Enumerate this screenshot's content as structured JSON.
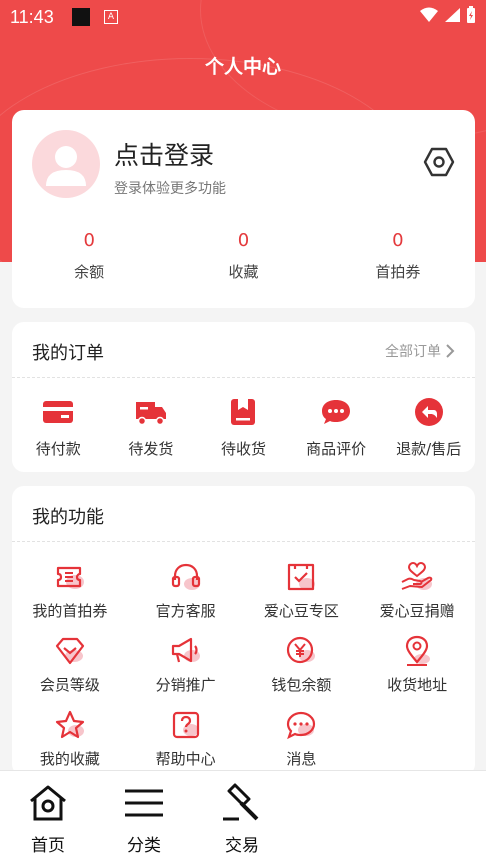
{
  "statusbar": {
    "time": "11:43",
    "a_icon": "A"
  },
  "page_title": "个人中心",
  "profile": {
    "login_title": "点击登录",
    "login_subtitle": "登录体验更多功能",
    "stats": [
      {
        "value": "0",
        "label": "余额"
      },
      {
        "value": "0",
        "label": "收藏"
      },
      {
        "value": "0",
        "label": "首拍券"
      }
    ]
  },
  "orders": {
    "title": "我的订单",
    "all_label": "全部订单",
    "items": [
      {
        "label": "待付款",
        "icon": "card-icon"
      },
      {
        "label": "待发货",
        "icon": "truck-icon"
      },
      {
        "label": "待收货",
        "icon": "box-icon"
      },
      {
        "label": "商品评价",
        "icon": "chat-bubble-icon"
      },
      {
        "label": "退款/售后",
        "icon": "return-icon"
      }
    ]
  },
  "functions": {
    "title": "我的功能",
    "items": [
      {
        "label": "我的首拍券",
        "icon": "ticket-icon"
      },
      {
        "label": "官方客服",
        "icon": "headset-icon"
      },
      {
        "label": "爱心豆专区",
        "icon": "cup-check-icon"
      },
      {
        "label": "爱心豆捐赠",
        "icon": "heart-hand-icon"
      },
      {
        "label": "会员等级",
        "icon": "badge-check-icon"
      },
      {
        "label": "分销推广",
        "icon": "megaphone-icon"
      },
      {
        "label": "钱包余额",
        "icon": "yen-coin-icon"
      },
      {
        "label": "收货地址",
        "icon": "location-pin-icon"
      },
      {
        "label": "我的收藏",
        "icon": "star-icon"
      },
      {
        "label": "帮助中心",
        "icon": "question-icon"
      },
      {
        "label": "消息",
        "icon": "message-icon"
      }
    ]
  },
  "tabbar": [
    {
      "label": "首页",
      "icon": "home-icon"
    },
    {
      "label": "分类",
      "icon": "menu-icon"
    },
    {
      "label": "交易",
      "icon": "gavel-icon"
    }
  ],
  "colors": {
    "brand_red": "#ee4a4a",
    "value_red": "#e4393c",
    "icon_pink": "#f7c5cb"
  }
}
